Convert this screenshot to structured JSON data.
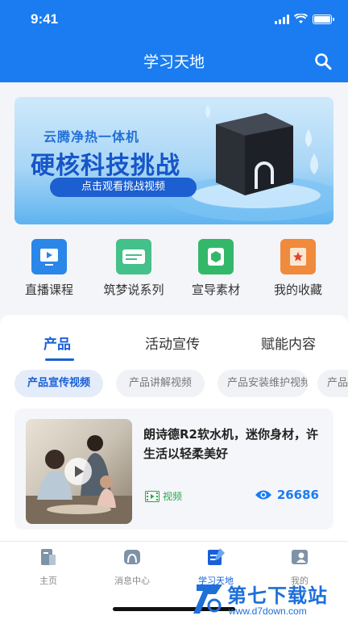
{
  "status_bar": {
    "time": "9:41"
  },
  "header": {
    "title": "学习天地"
  },
  "banner": {
    "subtitle": "云腾净热一体机",
    "headline": "硬核科技挑战",
    "button_label": "点击观看挑战视频"
  },
  "quick_links": [
    {
      "label": "直播课程",
      "icon": "live-course-icon",
      "color": "#2a86e8"
    },
    {
      "label": "筑梦说系列",
      "icon": "dream-series-icon",
      "color": "#44c08a"
    },
    {
      "label": "宣导素材",
      "icon": "materials-icon",
      "color": "#33b86a"
    },
    {
      "label": "我的收藏",
      "icon": "favorites-icon",
      "color": "#f08a3c"
    }
  ],
  "tabs": [
    {
      "label": "产品",
      "active": true
    },
    {
      "label": "活动宣传",
      "active": false
    },
    {
      "label": "赋能内容",
      "active": false
    }
  ],
  "chips": [
    {
      "label": "产品宣传视频",
      "active": true
    },
    {
      "label": "产品讲解视频",
      "active": false
    },
    {
      "label": "产品安装维护视频",
      "active": false
    },
    {
      "label": "产品",
      "active": false
    }
  ],
  "video_item": {
    "title": "朗诗德R2软水机，迷你身材，许生活以轻柔美好",
    "type_tag": "视频",
    "views": "26686"
  },
  "tabbar": [
    {
      "label": "主页",
      "icon": "home-icon",
      "active": false
    },
    {
      "label": "消息中心",
      "icon": "message-icon",
      "active": false
    },
    {
      "label": "学习天地",
      "icon": "study-icon",
      "active": true
    },
    {
      "label": "我的",
      "icon": "profile-icon",
      "active": false
    }
  ],
  "watermark": {
    "name": "第七下载站",
    "url": "www.d7down.com"
  },
  "colors": {
    "primary": "#1a7cf0",
    "accent": "#1a5fd8",
    "tag_green": "#2aa84a"
  }
}
